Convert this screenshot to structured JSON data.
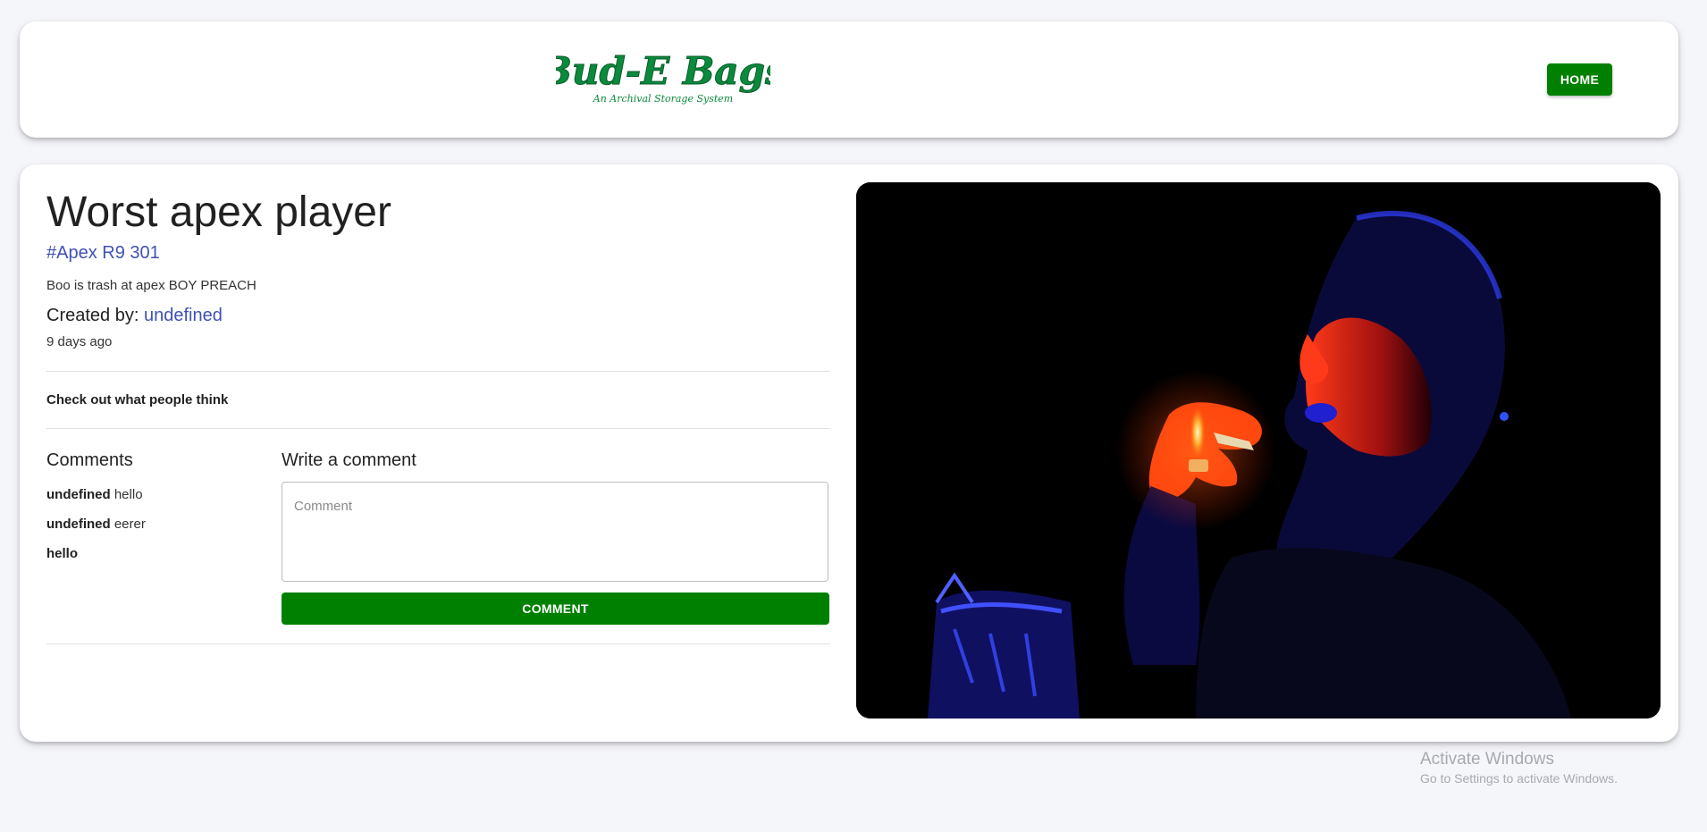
{
  "header": {
    "logo_text": "Bud-E Bags",
    "logo_tagline": "An Archival Storage System",
    "home_label": "HOME"
  },
  "post": {
    "title": "Worst apex player",
    "tags": "#Apex R9 301",
    "message": "Boo is trash at apex BOY PREACH",
    "created_by_label": "Created by:",
    "creator": "undefined",
    "time_ago": "9 days ago",
    "check_out_label": "Check out what people think",
    "image_alt": "Man lighting a joint with a lighter under blue and red light"
  },
  "comments": {
    "heading": "Comments",
    "items": [
      {
        "author": "undefined",
        "text": "hello"
      },
      {
        "author": "undefined",
        "text": "eerer"
      },
      {
        "author": "hello",
        "text": ""
      }
    ]
  },
  "write_comment": {
    "heading": "Write a comment",
    "placeholder": "Comment",
    "value": "",
    "button_label": "COMMENT"
  },
  "watermark": {
    "title": "Activate Windows",
    "subtitle": "Go to Settings to activate Windows."
  },
  "colors": {
    "accent_green": "#008000",
    "link_blue": "#3f51b5",
    "logo_green": "#0a8a3c",
    "background": "#f5f6fa"
  }
}
